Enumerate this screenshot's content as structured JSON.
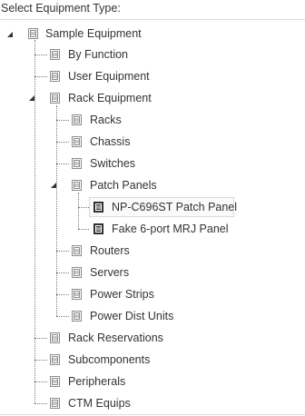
{
  "header": {
    "label": "Select Equipment Type:"
  },
  "tree": {
    "root": {
      "label": "Sample Equipment",
      "expanded": true,
      "icon": "document-icon"
    },
    "level1": [
      {
        "label": "By Function",
        "expanded": false
      },
      {
        "label": "User Equipment",
        "expanded": false
      },
      {
        "label": "Rack Equipment",
        "expanded": true
      },
      {
        "label": "Rack Reservations",
        "expanded": false
      },
      {
        "label": "Subcomponents",
        "expanded": false
      },
      {
        "label": "Peripherals",
        "expanded": false
      },
      {
        "label": "CTM Equips",
        "expanded": false
      }
    ],
    "rack_children": [
      {
        "label": "Racks",
        "expanded": false
      },
      {
        "label": "Chassis",
        "expanded": false
      },
      {
        "label": "Switches",
        "expanded": false
      },
      {
        "label": "Patch Panels",
        "expanded": true
      },
      {
        "label": "Routers",
        "expanded": false
      },
      {
        "label": "Servers",
        "expanded": false
      },
      {
        "label": "Power Strips",
        "expanded": false
      },
      {
        "label": "Power Dist Units",
        "expanded": false
      }
    ],
    "patch_children": [
      {
        "label": "NP-C696ST Patch Panel",
        "selected": true,
        "icon": "dark-document-icon"
      },
      {
        "label": "Fake 6-port MRJ Panel",
        "selected": false,
        "icon": "dark-document-icon"
      }
    ]
  },
  "colors": {
    "text": "#333333",
    "line": "#7a7a7a",
    "icon_light": "#8c8c8c",
    "icon_dark": "#3a3a3a",
    "selection_border": "#d9d9d9"
  }
}
